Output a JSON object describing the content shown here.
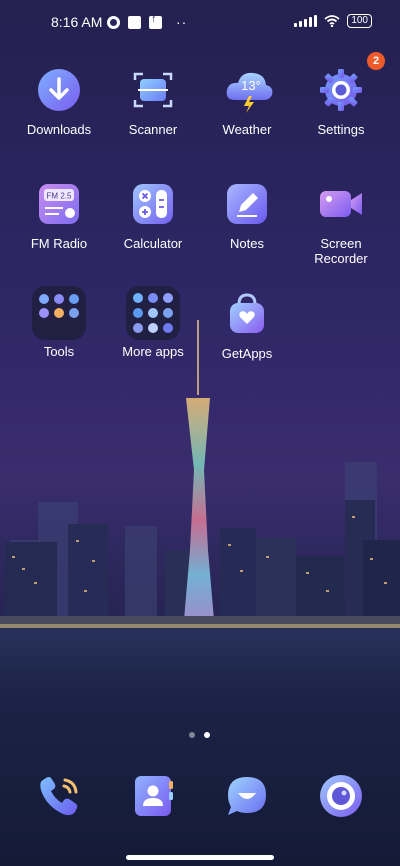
{
  "status_bar": {
    "time": "8:16 AM",
    "battery": "100"
  },
  "apps": [
    {
      "label": "Downloads",
      "icon": "downloads-icon"
    },
    {
      "label": "Scanner",
      "icon": "scanner-icon"
    },
    {
      "label": "Weather",
      "icon": "weather-icon",
      "temperature": "13°"
    },
    {
      "label": "Settings",
      "icon": "settings-icon",
      "badge": "2"
    },
    {
      "label": "FM Radio",
      "icon": "fm-radio-icon",
      "display": "FM 2.5"
    },
    {
      "label": "Calculator",
      "icon": "calculator-icon"
    },
    {
      "label": "Notes",
      "icon": "notes-icon"
    },
    {
      "label": "Screen Recorder",
      "icon": "screen-recorder-icon"
    },
    {
      "label": "Tools",
      "icon": "tools-folder-icon"
    },
    {
      "label": "More apps",
      "icon": "more-apps-folder-icon"
    },
    {
      "label": "GetApps",
      "icon": "getapps-icon"
    }
  ],
  "page_indicator": {
    "pages": 2,
    "current": 2
  },
  "dock": [
    {
      "icon": "phone-icon"
    },
    {
      "icon": "contacts-icon"
    },
    {
      "icon": "messages-icon"
    },
    {
      "icon": "camera-icon"
    }
  ],
  "colors": {
    "badge": "#ee5a2a",
    "accent_blue": "#4f7cf0",
    "accent_purple": "#8b5cf6"
  }
}
